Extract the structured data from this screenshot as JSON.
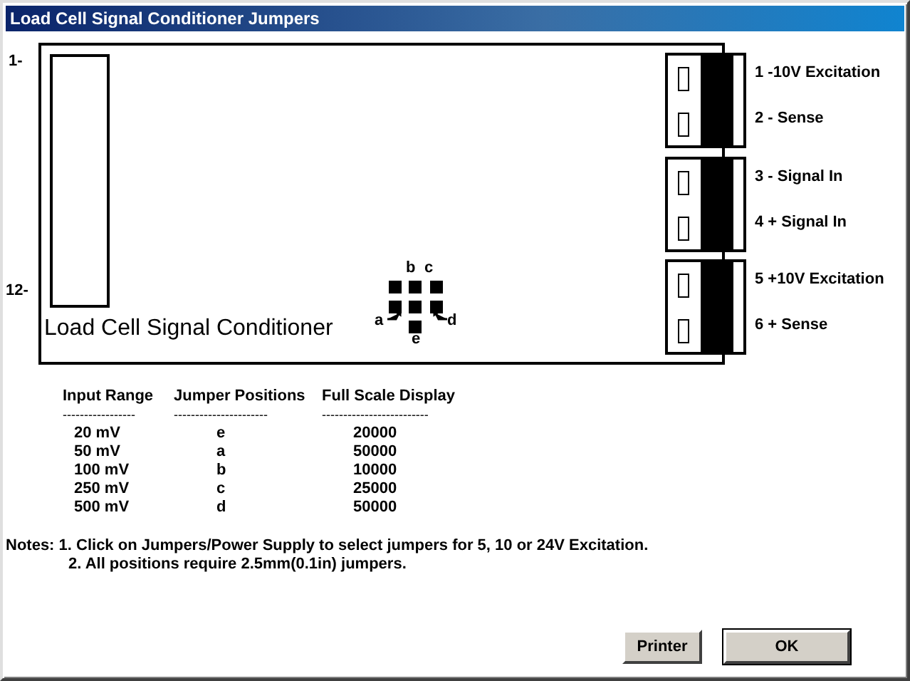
{
  "window": {
    "title": "Load Cell Signal Conditioner Jumpers"
  },
  "board": {
    "label": "Load Cell Signal Conditioner",
    "pin_markers": [
      "1-",
      "12-"
    ],
    "jumper_labels": [
      "b",
      "c",
      "a",
      "d",
      "e"
    ],
    "connectors": [
      {
        "pins": [
          "1 -10V Excitation",
          "2 - Sense"
        ]
      },
      {
        "pins": [
          "3 - Signal In",
          "4 + Signal In"
        ]
      },
      {
        "pins": [
          "5 +10V Excitation",
          "6 + Sense"
        ]
      }
    ]
  },
  "table": {
    "columns": [
      "Input Range",
      "Jumper Positions",
      "Full Scale Display"
    ],
    "separators": [
      "-----------------",
      "----------------------",
      "-------------------------"
    ],
    "rows": [
      [
        "20 mV",
        "e",
        "20000"
      ],
      [
        "50 mV",
        "a",
        "50000"
      ],
      [
        "100 mV",
        "b",
        "10000"
      ],
      [
        "250 mV",
        "c",
        "25000"
      ],
      [
        "500 mV",
        "d",
        "50000"
      ]
    ]
  },
  "notes": [
    "Notes: 1. Click on Jumpers/Power Supply to select jumpers for 5, 10 or 24V Excitation.",
    "2. All positions require 2.5mm(0.1in) jumpers."
  ],
  "buttons": [
    {
      "label": "Printer",
      "default": false
    },
    {
      "label": "OK",
      "default": true
    }
  ]
}
